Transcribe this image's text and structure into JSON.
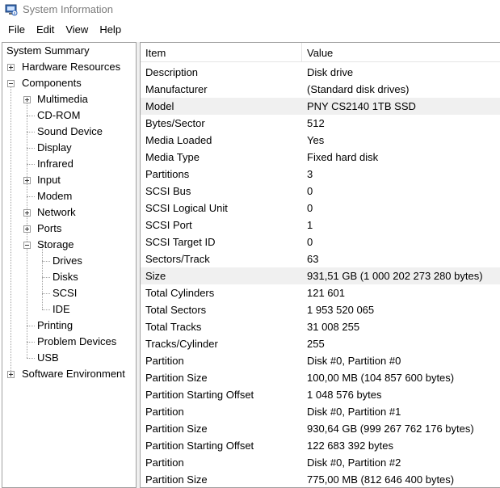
{
  "window": {
    "title": "System Information"
  },
  "menu": [
    "File",
    "Edit",
    "View",
    "Help"
  ],
  "tree": {
    "system_summary": "System Summary",
    "hardware_resources": "Hardware Resources",
    "components": "Components",
    "multimedia": "Multimedia",
    "cd_rom": "CD-ROM",
    "sound_device": "Sound Device",
    "display": "Display",
    "infrared": "Infrared",
    "input": "Input",
    "modem": "Modem",
    "network": "Network",
    "ports": "Ports",
    "storage": "Storage",
    "drives": "Drives",
    "disks": "Disks",
    "scsi": "SCSI",
    "ide": "IDE",
    "printing": "Printing",
    "problem_devices": "Problem Devices",
    "usb": "USB",
    "software_environment": "Software Environment"
  },
  "table": {
    "columns": [
      "Item",
      "Value"
    ],
    "rows": [
      {
        "item": "Description",
        "value": "Disk drive"
      },
      {
        "item": "Manufacturer",
        "value": "(Standard disk drives)"
      },
      {
        "item": "Model",
        "value": "PNY CS2140 1TB SSD"
      },
      {
        "item": "Bytes/Sector",
        "value": "512"
      },
      {
        "item": "Media Loaded",
        "value": "Yes"
      },
      {
        "item": "Media Type",
        "value": "Fixed hard disk"
      },
      {
        "item": "Partitions",
        "value": "3"
      },
      {
        "item": "SCSI Bus",
        "value": "0"
      },
      {
        "item": "SCSI Logical Unit",
        "value": "0"
      },
      {
        "item": "SCSI Port",
        "value": "1"
      },
      {
        "item": "SCSI Target ID",
        "value": "0"
      },
      {
        "item": "Sectors/Track",
        "value": "63"
      },
      {
        "item": "Size",
        "value": "931,51 GB (1 000 202 273 280 bytes)"
      },
      {
        "item": "Total Cylinders",
        "value": "121 601"
      },
      {
        "item": "Total Sectors",
        "value": "1 953 520 065"
      },
      {
        "item": "Total Tracks",
        "value": "31 008 255"
      },
      {
        "item": "Tracks/Cylinder",
        "value": "255"
      },
      {
        "item": "Partition",
        "value": "Disk #0, Partition #0"
      },
      {
        "item": "Partition Size",
        "value": "100,00 MB (104 857 600 bytes)"
      },
      {
        "item": "Partition Starting Offset",
        "value": "1 048 576 bytes"
      },
      {
        "item": "Partition",
        "value": "Disk #0, Partition #1"
      },
      {
        "item": "Partition Size",
        "value": "930,64 GB (999 267 762 176 bytes)"
      },
      {
        "item": "Partition Starting Offset",
        "value": "122 683 392 bytes"
      },
      {
        "item": "Partition",
        "value": "Disk #0, Partition #2"
      },
      {
        "item": "Partition Size",
        "value": "775,00 MB (812 646 400 bytes)"
      }
    ]
  }
}
